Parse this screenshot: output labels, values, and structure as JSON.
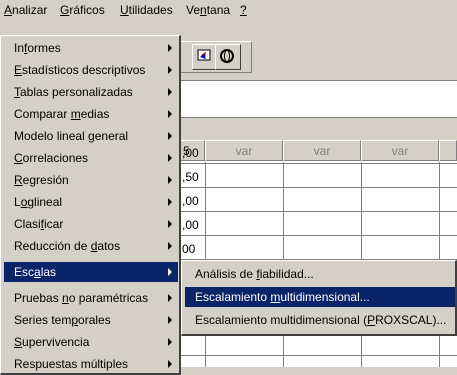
{
  "menubar": {
    "items": [
      {
        "label_pre": "",
        "label_u": "A",
        "label_post": "nalizar"
      },
      {
        "label_pre": "",
        "label_u": "G",
        "label_post": "ráficos"
      },
      {
        "label_pre": "",
        "label_u": "U",
        "label_post": "tilidades"
      },
      {
        "label_pre": "Ve",
        "label_u": "n",
        "label_post": "tana"
      },
      {
        "label_pre": "",
        "label_u": "?",
        "label_post": ""
      }
    ]
  },
  "grid": {
    "columns": [
      "5",
      "var",
      "var",
      "var"
    ],
    "values": [
      ",00",
      ",50",
      ",00",
      ",00",
      "00"
    ]
  },
  "analizar_menu": {
    "items": [
      {
        "pre": "In",
        "u": "f",
        "post": "ormes"
      },
      {
        "pre": "",
        "u": "E",
        "post": "stadísticos descriptivos"
      },
      {
        "pre": "",
        "u": "T",
        "post": "ablas personalizadas"
      },
      {
        "pre": "Comparar ",
        "u": "m",
        "post": "edias"
      },
      {
        "pre": "Modelo lineal general",
        "u": "",
        "post": ""
      },
      {
        "pre": "",
        "u": "C",
        "post": "orrelaciones"
      },
      {
        "pre": "",
        "u": "R",
        "post": "egresión"
      },
      {
        "pre": "L",
        "u": "o",
        "post": "glineal"
      },
      {
        "pre": "Clasi",
        "u": "f",
        "post": "icar"
      },
      {
        "pre": "Reducción de ",
        "u": "d",
        "post": "atos"
      },
      {
        "pre": "Esc",
        "u": "a",
        "post": "las"
      },
      {
        "pre": "Pruebas ",
        "u": "n",
        "post": "o paramétricas"
      },
      {
        "pre": "Series tem",
        "u": "p",
        "post": "orales"
      },
      {
        "pre": "",
        "u": "S",
        "post": "upervivencia"
      },
      {
        "pre": "Respuestas múltiples",
        "u": "",
        "post": ""
      }
    ]
  },
  "escalas_menu": {
    "items": [
      {
        "pre": "Análisis de ",
        "u": "f",
        "post": "iabilidad..."
      },
      {
        "pre": "Escalamiento ",
        "u": "m",
        "post": "ultidimensional..."
      },
      {
        "pre": "Escalamiento multidimensional (",
        "u": "P",
        "post": "ROXSCAL)..."
      }
    ]
  },
  "colors": {
    "selection": "#0a246a",
    "face": "#d4d0c8"
  }
}
